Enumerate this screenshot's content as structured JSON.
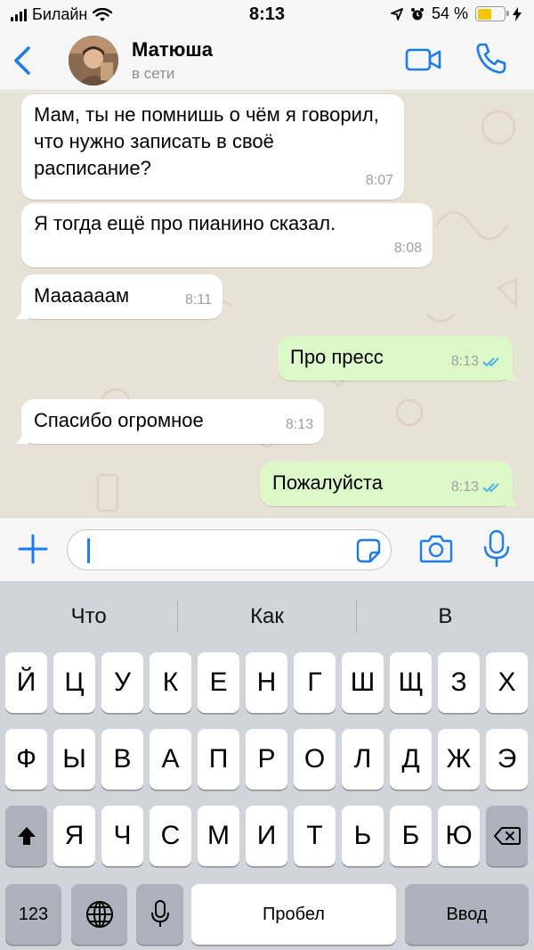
{
  "status_bar": {
    "carrier": "Билайн",
    "time": "8:13",
    "battery_percent": "54 %",
    "battery_level": 0.54
  },
  "header": {
    "contact_name": "Матюша",
    "contact_status": "в сети",
    "icons": [
      "chevron-left-icon",
      "video-icon",
      "phone-icon"
    ]
  },
  "messages": [
    {
      "direction": "in",
      "text": "Мам, ты не помнишь о чём я говорил, что нужно записать в своё расписание?",
      "time": "8:07"
    },
    {
      "direction": "in",
      "text": "Я тогда ещё про пианино сказал.",
      "time": "8:08"
    },
    {
      "direction": "in",
      "text": "Маааааам",
      "time": "8:11"
    },
    {
      "direction": "out",
      "text": "Про пресс",
      "time": "8:13",
      "status": "read"
    },
    {
      "direction": "in",
      "text": "Спасибо огромное",
      "time": "8:13"
    },
    {
      "direction": "out",
      "text": "Пожалуйста",
      "time": "8:13",
      "status": "read"
    }
  ],
  "input": {
    "value": "",
    "icons": [
      "plus-icon",
      "sticker-icon",
      "camera-icon",
      "microphone-icon"
    ]
  },
  "keyboard": {
    "suggestions": [
      "Что",
      "Как",
      "В"
    ],
    "row1": [
      "Й",
      "Ц",
      "У",
      "К",
      "Е",
      "Н",
      "Г",
      "Ш",
      "Щ",
      "З",
      "Х"
    ],
    "row2": [
      "Ф",
      "Ы",
      "В",
      "А",
      "П",
      "Р",
      "О",
      "Л",
      "Д",
      "Ж",
      "Э"
    ],
    "row3": [
      "Я",
      "Ч",
      "С",
      "М",
      "И",
      "Т",
      "Ь",
      "Б",
      "Ю"
    ],
    "numbers_key": "123",
    "space_key": "Пробел",
    "return_key": "Ввод"
  },
  "colors": {
    "accent": "#1a7cf3",
    "incoming_bubble": "#ffffff",
    "outgoing_bubble": "#dcf8c6",
    "read_ticks": "#4fb3e8",
    "chat_background": "#e8e2d6"
  }
}
